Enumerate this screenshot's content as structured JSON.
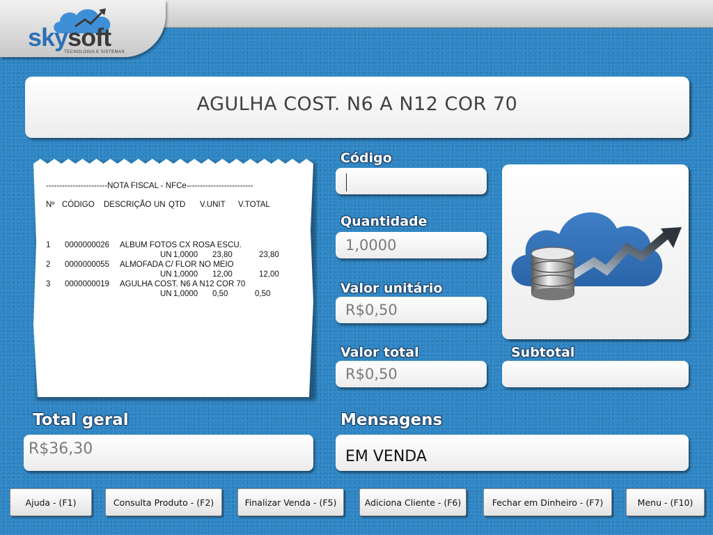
{
  "brand": {
    "name_part1": "sky",
    "name_part2": "soft",
    "tagline": "TECNOLOGIA E SISTEMAS",
    "primary_color": "#2c6fb7",
    "background_color": "#2f86c4"
  },
  "product_banner": "AGULHA COST. N6 A N12 COR 70",
  "receipt": {
    "header": "-----------------------NOTA FISCAL - NFCe-------------------------",
    "columns": [
      "Nº",
      "CÓDIGO",
      "DESCRIÇÃO",
      "UN",
      "QTD",
      "V.UNIT",
      "V.TOTAL"
    ],
    "items": [
      {
        "n": "1",
        "code": "0000000026",
        "desc": "ALBUM FOTOS CX ROSA ESCU.",
        "un": "UN",
        "qty": "1,0000",
        "unit": "23,80",
        "total": "23,80"
      },
      {
        "n": "2",
        "code": "0000000055",
        "desc": "ALMOFADA C/ FLOR NO MEIO",
        "un": "UN",
        "qty": "1,0000",
        "unit": "12,00",
        "total": "12,00"
      },
      {
        "n": "3",
        "code": "0000000019",
        "desc": "AGULHA COST. N6 A N12 COR 70",
        "un": "UN",
        "qty": "1,0000",
        "unit": "0,50",
        "total": "0,50"
      }
    ]
  },
  "fields": {
    "codigo": {
      "label": "Código",
      "value": ""
    },
    "quantidade": {
      "label": "Quantidade",
      "value": "1,0000"
    },
    "valor_unitario": {
      "label": "Valor unitário",
      "value": "R$0,50"
    },
    "valor_total": {
      "label": "Valor total",
      "value": "R$0,50"
    },
    "subtotal": {
      "label": "Subtotal",
      "value": ""
    },
    "total_geral": {
      "label": "Total geral",
      "value": "R$36,30"
    },
    "mensagens": {
      "label": "Mensagens",
      "value": "EM VENDA"
    }
  },
  "icons": {
    "logo": "cloud-database-chart-icon"
  },
  "buttons": [
    {
      "label": "Ajuda - (F1)"
    },
    {
      "label": "Consulta Produto - (F2)"
    },
    {
      "label": "Finalizar Venda - (F5)"
    },
    {
      "label": "Adiciona Cliente - (F6)"
    },
    {
      "label": "Fechar em Dinheiro - (F7)"
    },
    {
      "label": "Menu - (F10)"
    }
  ]
}
